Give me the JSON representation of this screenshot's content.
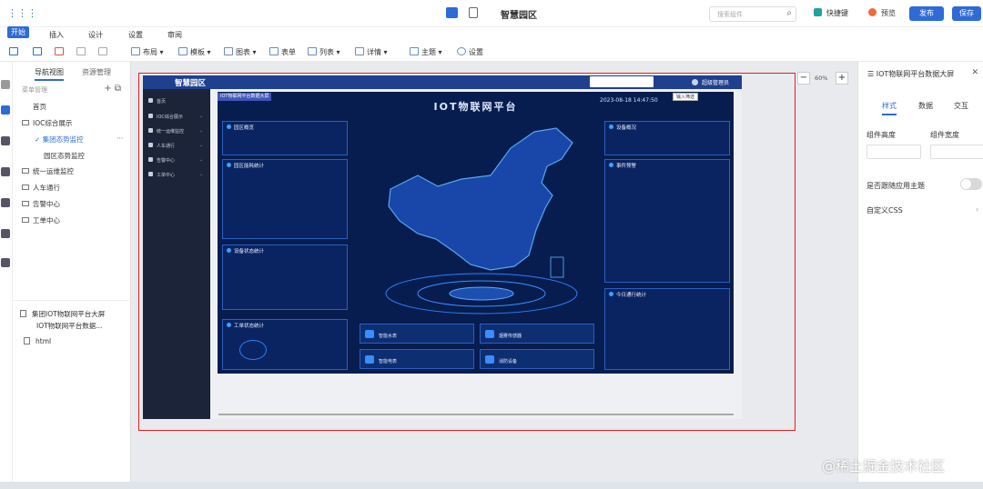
{
  "topbar": {
    "title": "智慧园区",
    "search_placeholder": "搜索组件",
    "shortcut_label": "快捷键",
    "preview_label": "预览",
    "publish_label": "发布",
    "save_label": "保存"
  },
  "menus": [
    "开始",
    "插入",
    "设计",
    "设置",
    "审阅"
  ],
  "toolbar": [
    "布局",
    "模板",
    "图表",
    "表单",
    "列表",
    "详情",
    "主题",
    "设置"
  ],
  "sidebar": {
    "tabs": [
      "导航视图",
      "资源管理"
    ],
    "section": "菜单管理",
    "tree": [
      "首页",
      "IOC综合展示",
      "集团态势监控",
      "园区态势监控",
      "统一运维监控",
      "人车通行",
      "告警中心",
      "工单中心"
    ],
    "pages": [
      "集团IOT物联网平台大屏",
      "IOT物联网平台数据...",
      "html"
    ]
  },
  "canvas": {
    "zoom": "60%",
    "app": {
      "logo": "智慧园区",
      "user": "超级管理员",
      "nav": [
        "首页",
        "IOC综合展示",
        "统一运维监控",
        "人车通行",
        "告警中心",
        "工单中心"
      ]
    },
    "dashboard": {
      "tag": "IOT物联网平台数据大屏",
      "title": "IOT物联网平台",
      "datetime": "2023-08-18 14:47:50",
      "actions": "输入筛选",
      "panels": [
        "园区概览",
        "园区能耗统计",
        "设备状态统计",
        "工单状态统计",
        "设备概况",
        "事件预警",
        "今日通行统计"
      ],
      "cards": [
        "智能水表",
        "智能电表",
        "烟雾传感器",
        "消防设备"
      ]
    }
  },
  "right_panel": {
    "title": "IOT物联网平台数据大屏",
    "tabs": [
      "样式",
      "数据",
      "交互"
    ],
    "height_label": "组件高度",
    "width_label": "组件宽度",
    "theme_label": "是否跟随应用主题",
    "css_label": "自定义CSS"
  },
  "watermark": "@稀土掘金技术社区"
}
